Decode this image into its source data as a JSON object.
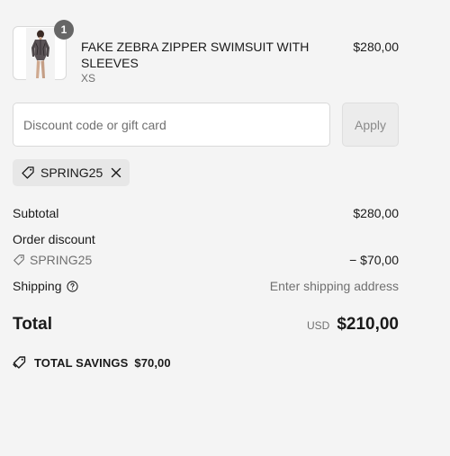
{
  "line_item": {
    "quantity": "1",
    "name": "FAKE ZEBRA ZIPPER SWIMSUIT WITH SLEEVES",
    "variant": "XS",
    "price": "$280,00",
    "thumbnail_icon": "swimsuit-product-image"
  },
  "discount": {
    "placeholder": "Discount code or gift card",
    "value": "",
    "apply_label": "Apply"
  },
  "applied_code": {
    "code": "SPRING25",
    "icon": "tag-icon",
    "remove_icon": "close-icon"
  },
  "totals": {
    "subtotal_label": "Subtotal",
    "subtotal_value": "$280,00",
    "order_discount_label": "Order discount",
    "discount_code": "SPRING25",
    "discount_value": "− $70,00",
    "shipping_label": "Shipping",
    "shipping_value": "Enter shipping address",
    "total_label": "Total",
    "currency": "USD",
    "total_value": "$210,00"
  },
  "savings": {
    "label": "TOTAL SAVINGS",
    "amount": "$70,00"
  }
}
